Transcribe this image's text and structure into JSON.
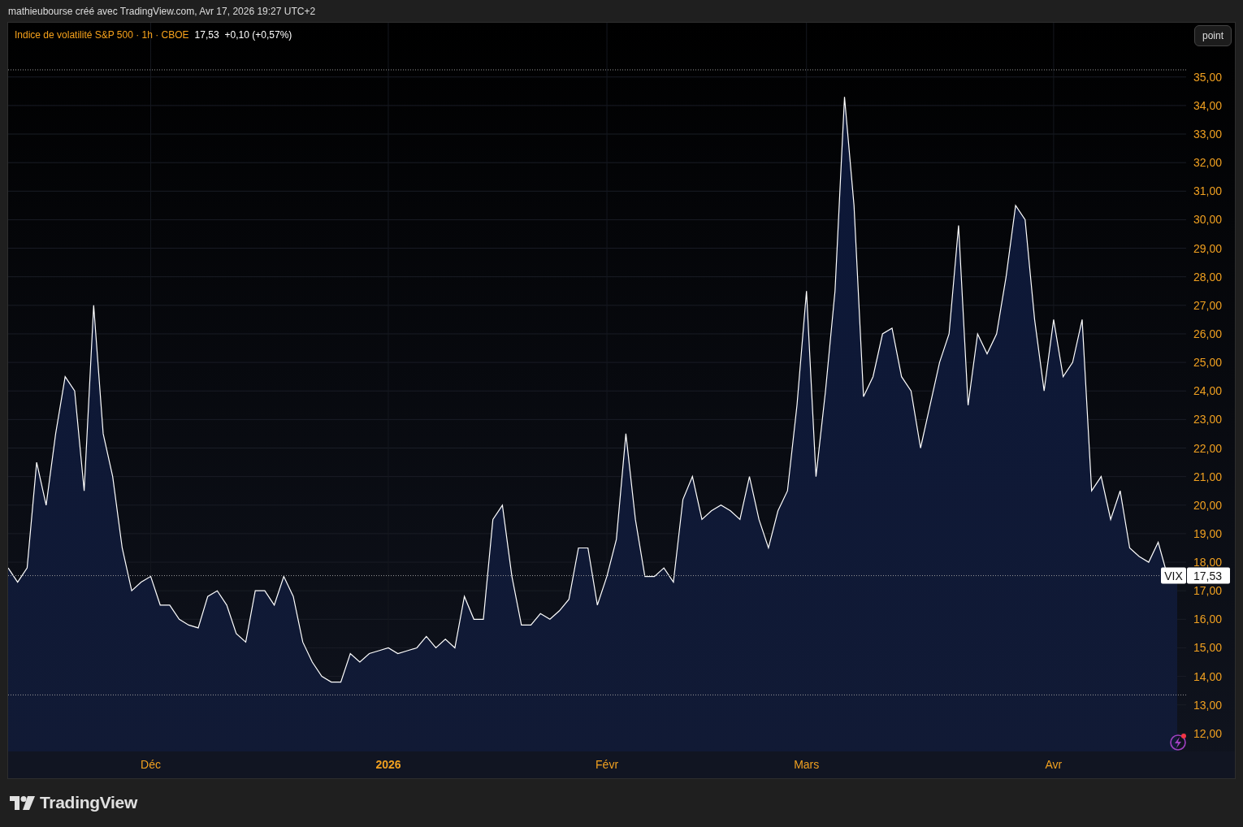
{
  "header": {
    "caption": "mathieubourse créé avec TradingView.com, Avr 17, 2026 19:27 UTC+2"
  },
  "legend": {
    "title": "Indice de volatilité S&P 500 · 1h · CBOE",
    "price": "17,53",
    "change": "+0,10 (+0,57%)"
  },
  "scale_button": {
    "label": "point"
  },
  "price_label": {
    "value": "17,53"
  },
  "chart": {
    "time_labels_bold": [
      false,
      true,
      false,
      false,
      false
    ],
    "chart_data": {
      "type": "area",
      "grid": true,
      "ylim": [
        11.37,
        36.9
      ],
      "ref_lines": [
        {
          "axis": "y",
          "value": 35.25
        },
        {
          "axis": "y",
          "value": 17.53
        },
        {
          "axis": "y",
          "value": 13.35
        }
      ],
      "yticks": [
        {
          "value": 12,
          "label": "12,00"
        },
        {
          "value": 13,
          "label": "13,00"
        },
        {
          "value": 14,
          "label": "14,00"
        },
        {
          "value": 15,
          "label": "15,00"
        },
        {
          "value": 16,
          "label": "16,00"
        },
        {
          "value": 17,
          "label": "17,00"
        },
        {
          "value": 18,
          "label": "18,00"
        },
        {
          "value": 19,
          "label": "19,00"
        },
        {
          "value": 20,
          "label": "20,00"
        },
        {
          "value": 21,
          "label": "21,00"
        },
        {
          "value": 22,
          "label": "22,00"
        },
        {
          "value": 23,
          "label": "23,00"
        },
        {
          "value": 24,
          "label": "24,00"
        },
        {
          "value": 25,
          "label": "25,00"
        },
        {
          "value": 26,
          "label": "26,00"
        },
        {
          "value": 27,
          "label": "27,00"
        },
        {
          "value": 28,
          "label": "28,00"
        },
        {
          "value": 29,
          "label": "29,00"
        },
        {
          "value": 30,
          "label": "30,00"
        },
        {
          "value": 31,
          "label": "31,00"
        },
        {
          "value": 32,
          "label": "32,00"
        },
        {
          "value": 33,
          "label": "33,00"
        },
        {
          "value": 34,
          "label": "34,00"
        },
        {
          "value": 35,
          "label": "35,00"
        }
      ],
      "categories": [
        null,
        null,
        null,
        null,
        null,
        null,
        null,
        null,
        null,
        null,
        null,
        null,
        null,
        null,
        null,
        "Déc",
        null,
        null,
        null,
        null,
        null,
        null,
        null,
        null,
        null,
        null,
        null,
        null,
        null,
        null,
        null,
        null,
        null,
        null,
        null,
        null,
        null,
        null,
        null,
        null,
        "2026",
        null,
        null,
        null,
        null,
        null,
        null,
        null,
        null,
        null,
        null,
        null,
        null,
        null,
        null,
        null,
        null,
        null,
        null,
        null,
        null,
        null,
        null,
        "Févr",
        null,
        null,
        null,
        null,
        null,
        null,
        null,
        null,
        null,
        null,
        null,
        null,
        null,
        null,
        null,
        null,
        null,
        null,
        null,
        null,
        "Mars",
        null,
        null,
        null,
        null,
        null,
        null,
        null,
        null,
        null,
        null,
        null,
        null,
        null,
        null,
        null,
        null,
        null,
        null,
        null,
        null,
        null,
        null,
        null,
        null,
        null,
        "Avr",
        null,
        null,
        null,
        null,
        null,
        null,
        null,
        null,
        null,
        null,
        null,
        null,
        null
      ],
      "series": [
        {
          "name": "VIX",
          "color": "#ffffff",
          "values": [
            17.8,
            17.3,
            17.8,
            21.5,
            20.0,
            22.5,
            24.5,
            24.0,
            20.5,
            27.0,
            22.5,
            21.0,
            18.5,
            17.0,
            17.3,
            17.5,
            16.5,
            16.5,
            16.0,
            15.8,
            15.7,
            16.8,
            17.0,
            16.5,
            15.5,
            15.2,
            17.0,
            17.0,
            16.5,
            17.5,
            16.8,
            15.2,
            14.5,
            14.0,
            13.8,
            13.8,
            14.8,
            14.5,
            14.8,
            14.9,
            15.0,
            14.8,
            14.9,
            15.0,
            15.4,
            15.0,
            15.3,
            15.0,
            16.8,
            16.0,
            16.0,
            19.5,
            20.0,
            17.5,
            15.8,
            15.8,
            16.2,
            16.0,
            16.3,
            16.7,
            18.5,
            18.5,
            16.5,
            17.5,
            18.8,
            22.5,
            19.5,
            17.5,
            17.5,
            17.8,
            17.3,
            20.2,
            21.0,
            19.5,
            19.8,
            20.0,
            19.8,
            19.5,
            21.0,
            19.5,
            18.5,
            19.8,
            20.5,
            23.5,
            27.5,
            21.0,
            24.0,
            27.5,
            34.3,
            30.5,
            23.8,
            24.5,
            26.0,
            26.2,
            24.5,
            24.0,
            22.0,
            23.5,
            25.0,
            26.0,
            29.8,
            23.5,
            26.0,
            25.3,
            26.0,
            28.0,
            30.5,
            30.0,
            26.5,
            24.0,
            26.5,
            24.5,
            25.0,
            26.5,
            20.5,
            21.0,
            19.5,
            20.5,
            18.5,
            18.2,
            18.0,
            18.7,
            17.5,
            17.53
          ]
        }
      ]
    }
  },
  "footer": {
    "brand": "TradingView"
  }
}
